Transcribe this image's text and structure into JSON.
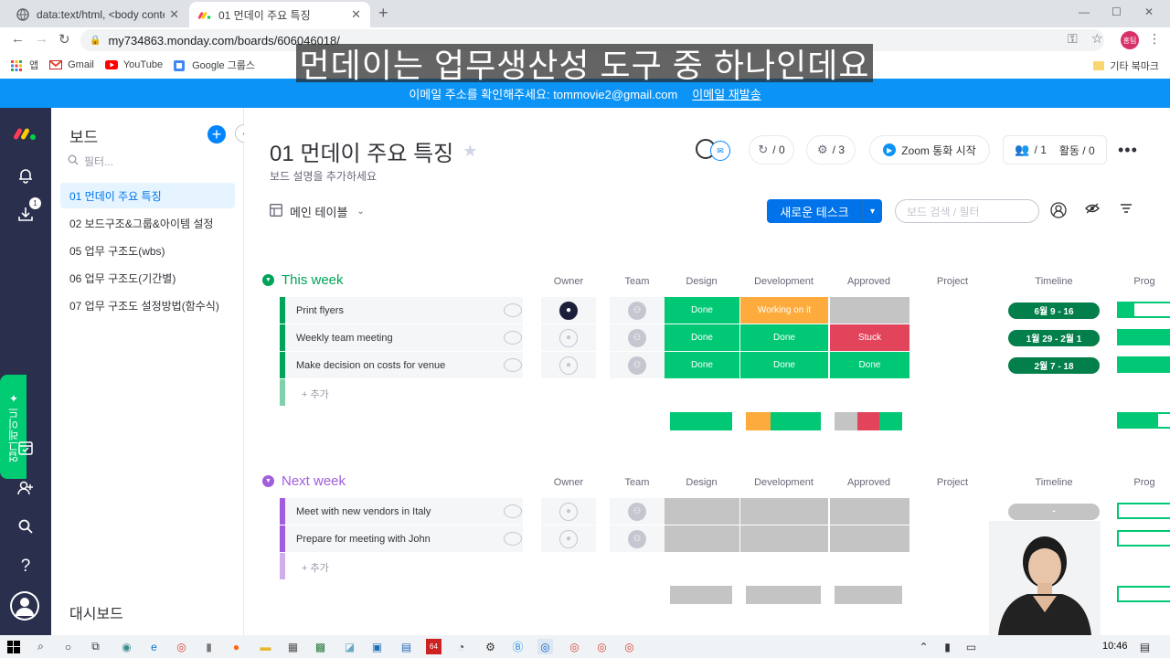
{
  "browser": {
    "tabs": [
      {
        "title": "data:text/html, <body contente"
      },
      {
        "title": "01 먼데이 주요 특징"
      }
    ],
    "url": "my734863.monday.com/boards/606046018/",
    "profile_label": "홍팀",
    "bookmarks": [
      {
        "label": "앱"
      },
      {
        "label": "Gmail"
      },
      {
        "label": "YouTube"
      },
      {
        "label": "Google 그룹스"
      }
    ],
    "other_bookmarks": "기타 북마크"
  },
  "caption": "먼데이는 업무생산성 도구 중 하나인데요",
  "banner": {
    "message": "이메일 주소를 확인해주세요: tommovie2@gmail.com",
    "resend": "이메일 재발송"
  },
  "leftnav": {
    "upgrade_label": "업그레이드 ✦",
    "download_badge": "1"
  },
  "boards_panel": {
    "title": "보드",
    "filter_placeholder": "필터...",
    "items": [
      {
        "label": "01 먼데이 주요 특징"
      },
      {
        "label": "02 보드구조&그룹&아이템 설정"
      },
      {
        "label": "05 업무 구조도(wbs)"
      },
      {
        "label": "06 업무 구조도(기간별)"
      },
      {
        "label": "07 업무 구조도 설정방법(함수식)"
      }
    ],
    "dashboard": "대시보드"
  },
  "board": {
    "title": "01 먼데이 주요 특징",
    "description": "보드 설명을 추가하세요",
    "activity_zero": "/ 0",
    "updates_count": "/ 3",
    "zoom": "Zoom 통화 시작",
    "members": "/ 1",
    "activity": "활동 / 0",
    "view": "메인 테이블",
    "new_task": "새로운 테스크",
    "search_placeholder": "보드 검색 / 필터"
  },
  "columns": [
    "Owner",
    "Team",
    "Design",
    "Development",
    "Approved",
    "Project",
    "Timeline",
    "Prog"
  ],
  "add_item": "+ 추가",
  "groups": [
    {
      "name": "This week",
      "color": "#00a359",
      "rows": [
        {
          "name": "Print flyers",
          "owner": "filled",
          "design": "Done",
          "development": "Working on it",
          "approved": "",
          "timeline": "6월 9 - 16",
          "progress": 0.3
        },
        {
          "name": "Weekly team meeting",
          "owner": "empty",
          "design": "Done",
          "development": "Done",
          "approved": "Stuck",
          "timeline": "1월 29 - 2월 1",
          "progress": 1.0
        },
        {
          "name": "Make decision on costs for venue",
          "owner": "empty",
          "design": "Done",
          "development": "Done",
          "approved": "Done",
          "timeline": "2월 7 - 18",
          "progress": 1.0
        }
      ]
    },
    {
      "name": "Next week",
      "color": "#a25ddc",
      "rows": [
        {
          "name": "Meet with new vendors in Italy",
          "owner": "empty",
          "design": "",
          "development": "",
          "approved": "",
          "timeline": "-",
          "progress": 0.0
        },
        {
          "name": "Prepare for meeting with John",
          "owner": "empty",
          "design": "",
          "development": "",
          "approved": "",
          "timeline": "",
          "progress": 0.0
        }
      ]
    }
  ],
  "status_colors": {
    "Done": "#00c875",
    "Working on it": "#fdab3d",
    "Stuck": "#e2445c",
    "empty": "#c4c4c4"
  },
  "taskbar": {
    "time": "10:46"
  }
}
